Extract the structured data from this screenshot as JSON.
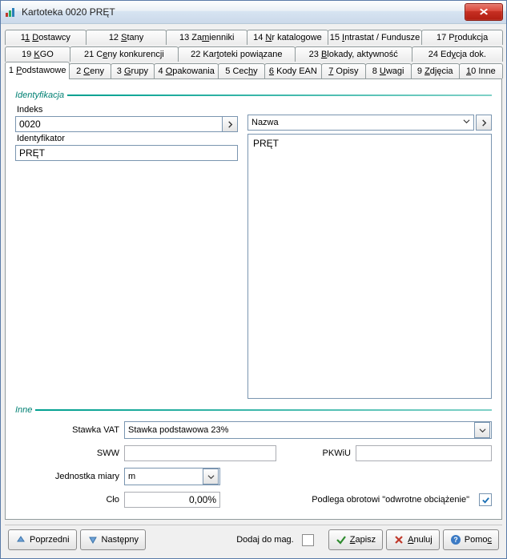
{
  "window": {
    "title": "Kartoteka  0020  PRĘT"
  },
  "tabs": {
    "row1": [
      {
        "label": "11 Dostawcy",
        "u": "D"
      },
      {
        "label": "12 Stany",
        "u": "S"
      },
      {
        "label": "13 Zamienniki",
        "u": "m"
      },
      {
        "label": "14 Nr katalogowe",
        "u": "N"
      },
      {
        "label": "15 Intrastat / Fundusze",
        "u": "I"
      },
      {
        "label": "17 Produkcja",
        "u": "r"
      }
    ],
    "row2": [
      {
        "label": "19 KGO",
        "u": "K"
      },
      {
        "label": "21 Ceny konkurencji",
        "u": "e"
      },
      {
        "label": "22 Kartoteki powiązane",
        "u": "t"
      },
      {
        "label": "23 Blokady, aktywność",
        "u": "B"
      },
      {
        "label": "24 Edycja dok.",
        "u": "y"
      }
    ],
    "row3": [
      {
        "label": "1 Podstawowe",
        "u": "P",
        "active": true
      },
      {
        "label": "2 Ceny",
        "u": "C"
      },
      {
        "label": "3 Grupy",
        "u": "G"
      },
      {
        "label": "4 Opakowania",
        "u": "O"
      },
      {
        "label": "5 Cechy",
        "u": "h"
      },
      {
        "label": "6 Kody EAN",
        "u": "6"
      },
      {
        "label": "7 Opisy",
        "u": "7"
      },
      {
        "label": "8 Uwagi",
        "u": "U"
      },
      {
        "label": "9 Zdjęcia",
        "u": "Z"
      },
      {
        "label": "10 Inne",
        "u": "1"
      }
    ]
  },
  "section": {
    "identyfikacja": "Identyfikacja",
    "inne": "Inne"
  },
  "fields": {
    "indeks_label": "Indeks",
    "indeks_value": "0020",
    "identyfikator_label": "Identyfikator",
    "identyfikator_value": "PRĘT",
    "nazwa_label": "Nazwa",
    "nazwa_value": "PRĘT"
  },
  "inne": {
    "stawka_vat_label": "Stawka VAT",
    "stawka_vat_value": "Stawka podstawowa 23%",
    "sww_label": "SWW",
    "sww_value": "",
    "pkwiu_label": "PKWiU",
    "pkwiu_value": "",
    "jednostka_label": "Jednostka miary",
    "jednostka_value": "m",
    "clo_label": "Cło",
    "clo_value": "0,00%",
    "odwrotne_label": "Podlega obrotowi \"odwrotne obciążenie\"",
    "odwrotne_checked": true
  },
  "bottom": {
    "poprzedni": "Poprzedni",
    "nastepny": "Następny",
    "dodaj": "Dodaj do mag.",
    "zapisz": "Zapisz",
    "anuluj": "Anuluj",
    "pomoc": "Pomoc"
  }
}
